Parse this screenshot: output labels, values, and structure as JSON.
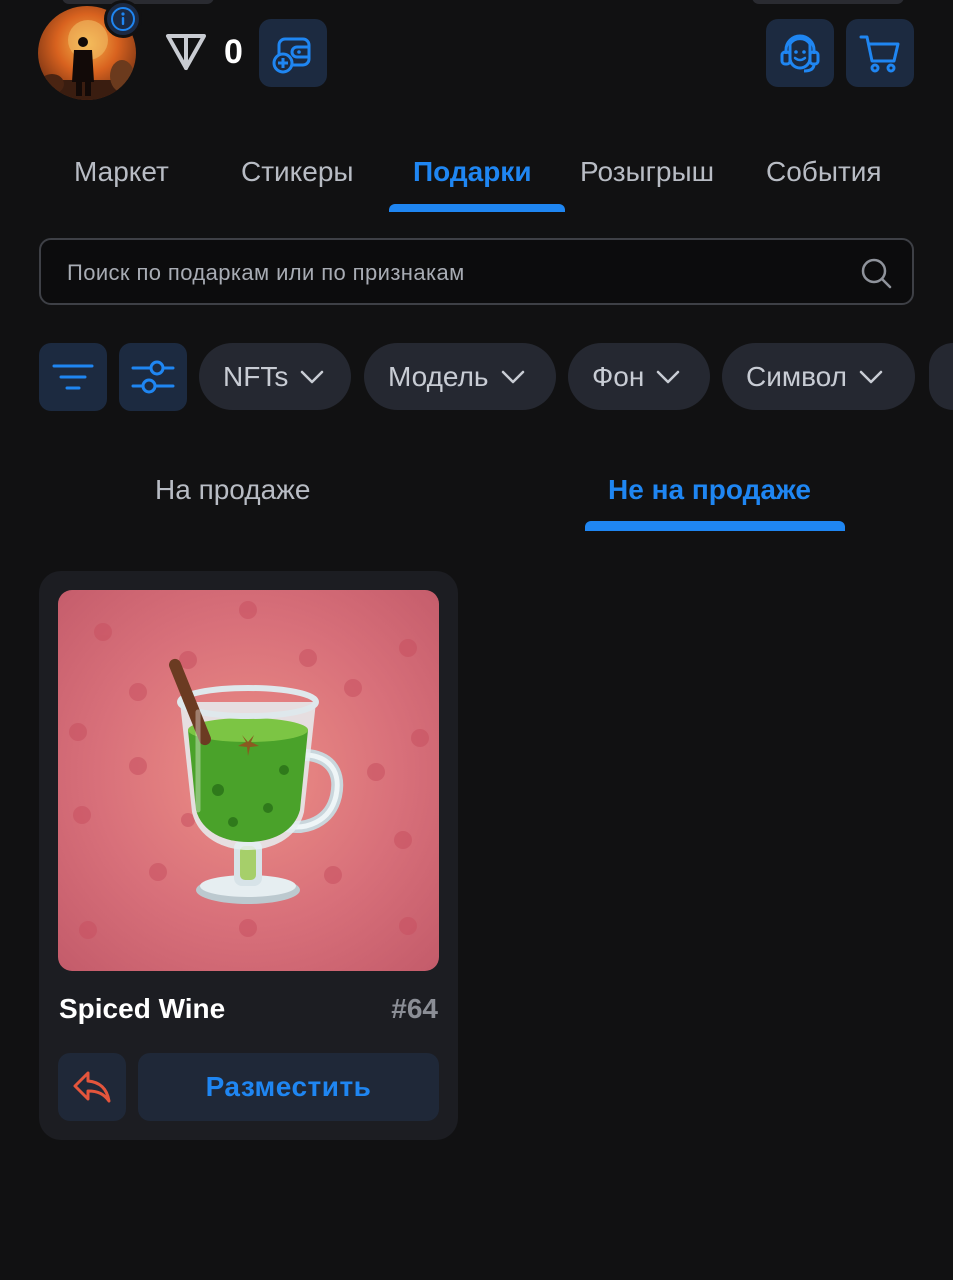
{
  "header": {
    "balance": "0",
    "icons": {
      "info": "info-icon",
      "currency": "ton-icon",
      "wallet_add": "wallet-add-icon",
      "support": "support-headset-icon",
      "cart": "cart-icon"
    }
  },
  "tabs": [
    {
      "label": "Маркет",
      "active": false
    },
    {
      "label": "Стикеры",
      "active": false
    },
    {
      "label": "Подарки",
      "active": true
    },
    {
      "label": "Розыгрыш",
      "active": false
    },
    {
      "label": "События",
      "active": false
    }
  ],
  "search": {
    "placeholder": "Поиск по подаркам или по признакам",
    "value": ""
  },
  "filters": {
    "chips": [
      {
        "label": "NFTs"
      },
      {
        "label": "Модель"
      },
      {
        "label": "Фон"
      },
      {
        "label": "Символ"
      }
    ]
  },
  "subtabs": [
    {
      "label": "На продаже",
      "active": false
    },
    {
      "label": "Не на продаже",
      "active": true
    }
  ],
  "gifts": [
    {
      "name": "Spiced Wine",
      "number": "#64",
      "action_label": "Разместить"
    }
  ],
  "colors": {
    "background": "#111112",
    "accent": "#1f86f2",
    "button_bg": "#1c2a40",
    "chip_bg": "#252831",
    "card_bg": "#1c1d22",
    "transfer_icon": "#e4553c",
    "gift_bg": "#d8707a"
  }
}
